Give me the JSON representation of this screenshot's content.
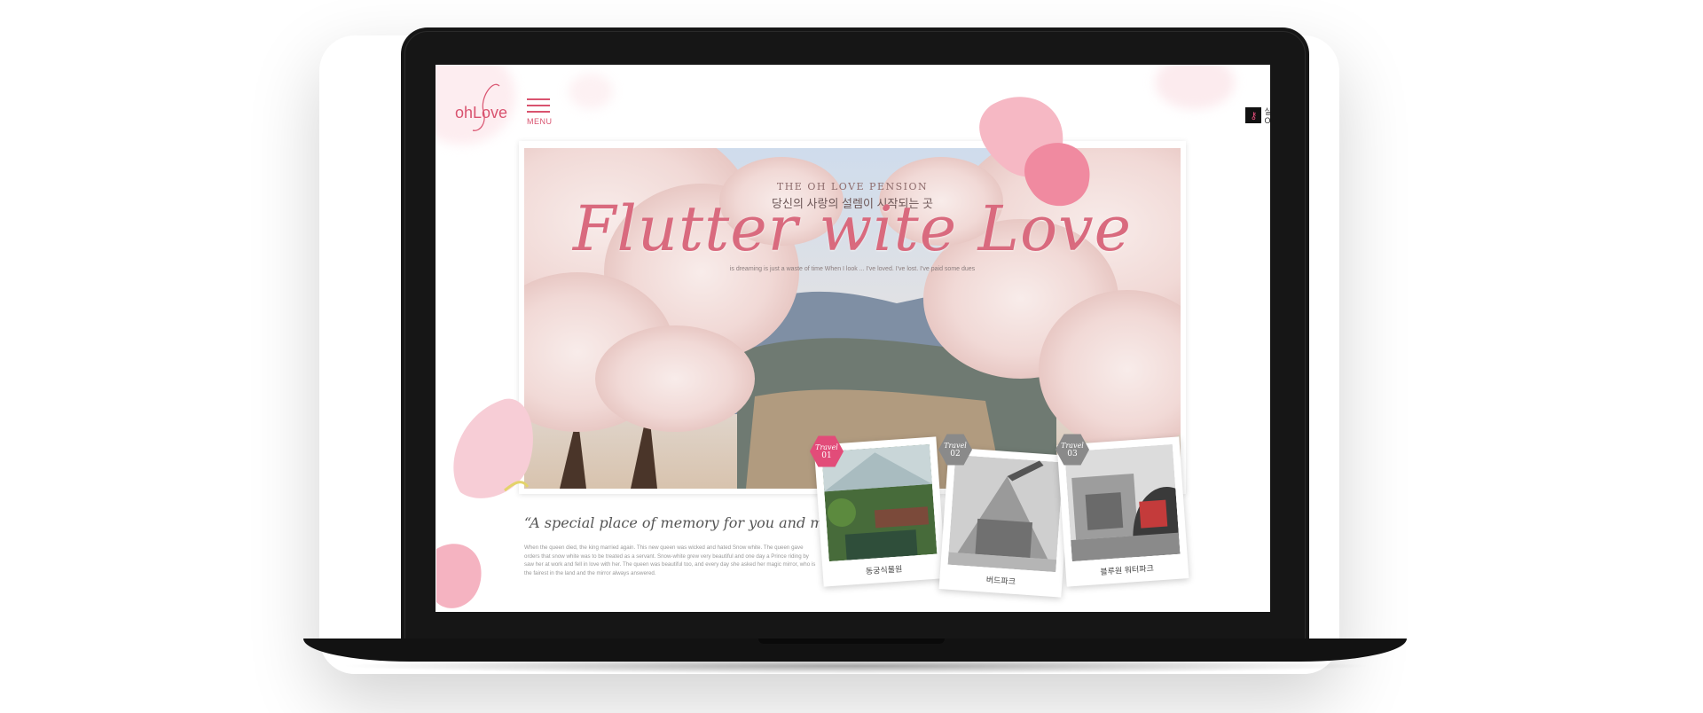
{
  "header": {
    "logo_text": "ohLove",
    "menu_label": "MENU"
  },
  "side_widget": {
    "line1": "실시",
    "line2": "OH"
  },
  "hero": {
    "subtitle": "THE OH LOVE PENSION",
    "korean_tagline": "당신의 사랑의 설렘이 시작되는 곳",
    "title": "Flutter wite Love",
    "small_text": "is dreaming is just a waste of time When I look ... I've loved. I've lost. I've paid some dues"
  },
  "intro": {
    "quote": "“A special place of memory for you and me”",
    "body": "When the queen died, the king married again. This new queen was wicked and hated Snow white. The queen gave orders that snow white was to be treated as a servant. Snow-white grew very beautiful and one day a Prince riding by saw her at work and fell in love with her. The queen was beautiful too, and every day she asked her magic mirror, who is the fairest in the land and the mirror always answered."
  },
  "travel": [
    {
      "badge_word": "Travel",
      "badge_num": "01",
      "caption": "동궁식물원",
      "badge_color": "#e24c79"
    },
    {
      "badge_word": "Travel",
      "badge_num": "02",
      "caption": "버드파크",
      "badge_color": "#8a8a8a"
    },
    {
      "badge_word": "Travel",
      "badge_num": "03",
      "caption": "블루원 워터파크",
      "badge_color": "#8a8a8a"
    }
  ],
  "colors": {
    "accent_pink": "#e24c79",
    "title_pink": "#d96a7e",
    "laptop_black": "#161616"
  }
}
